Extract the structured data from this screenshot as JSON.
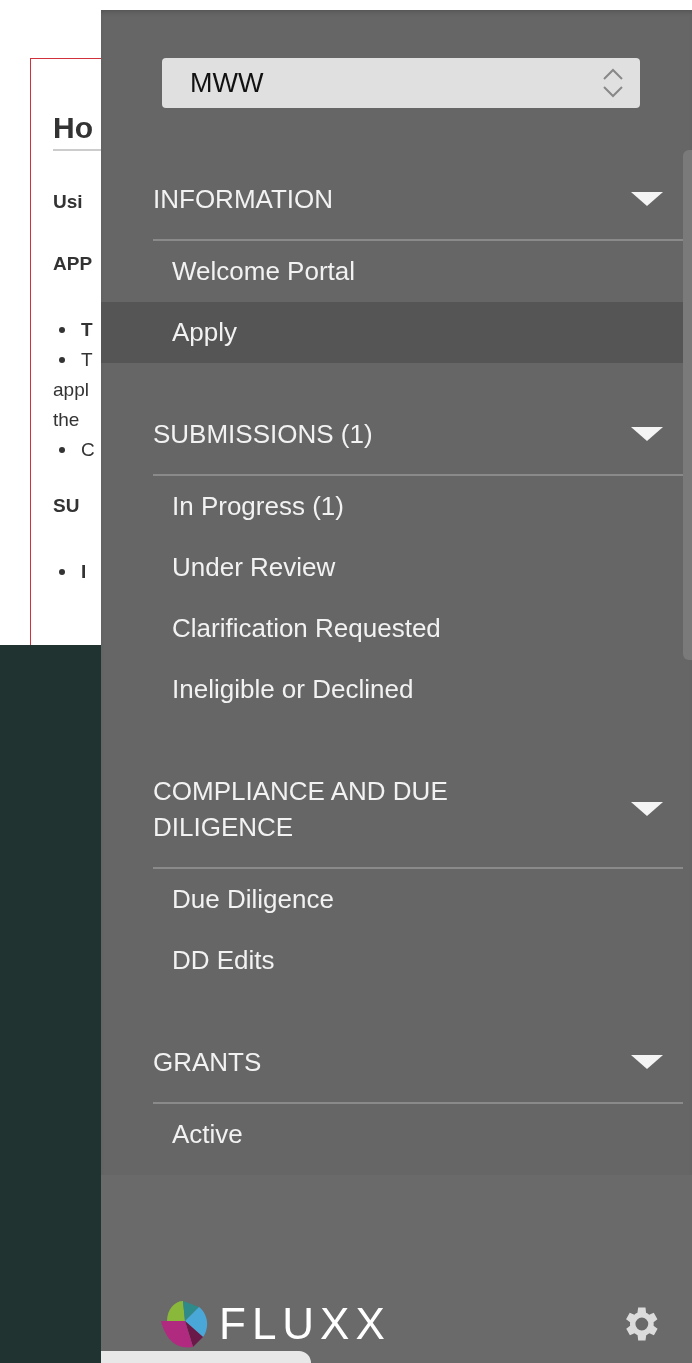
{
  "background_page": {
    "lines": [
      {
        "kind": "heading",
        "text": "Ho"
      },
      {
        "kind": "bold",
        "text": "Usi"
      },
      {
        "kind": "bold",
        "text": "APP"
      },
      {
        "kind": "bullet-bold",
        "text": "T"
      },
      {
        "kind": "bullet",
        "text": "T"
      },
      {
        "kind": "plain",
        "text": "appl"
      },
      {
        "kind": "plain",
        "text": "the"
      },
      {
        "kind": "bullet",
        "text": "C"
      },
      {
        "kind": "bold-spaced",
        "text": "SU"
      },
      {
        "kind": "bullet-bold",
        "text": "I"
      }
    ]
  },
  "sidebar": {
    "program_select": {
      "value": "MWW"
    },
    "sections": [
      {
        "title": "INFORMATION",
        "expanded": true,
        "items": [
          {
            "label": "Welcome Portal",
            "selected": false
          },
          {
            "label": "Apply",
            "selected": true
          }
        ]
      },
      {
        "title": "SUBMISSIONS (1)",
        "expanded": true,
        "items": [
          {
            "label": "In Progress  (1)",
            "selected": false
          },
          {
            "label": "Under Review",
            "selected": false
          },
          {
            "label": "Clarification Requested",
            "selected": false
          },
          {
            "label": "Ineligible or Declined",
            "selected": false
          }
        ]
      },
      {
        "title": "COMPLIANCE AND DUE DILIGENCE",
        "expanded": true,
        "items": [
          {
            "label": "Due Diligence",
            "selected": false
          },
          {
            "label": "DD Edits",
            "selected": false
          }
        ]
      },
      {
        "title": "GRANTS",
        "expanded": true,
        "items": [
          {
            "label": "Active",
            "selected": false
          }
        ]
      }
    ],
    "footer": {
      "logo_text": "FLUXX"
    }
  }
}
